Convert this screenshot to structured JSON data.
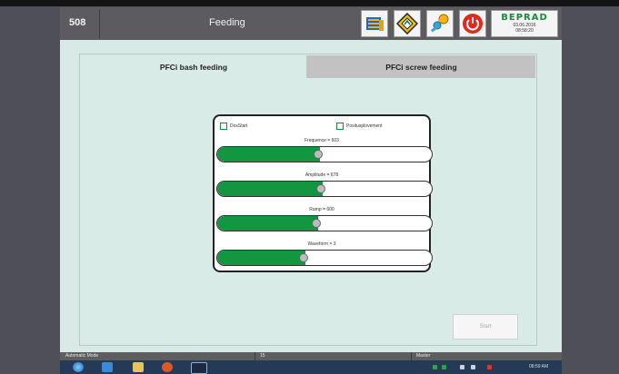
{
  "header": {
    "screen_number": "508",
    "title": "Feeding",
    "buttons": [
      "notebook-icon",
      "navigation-diamond-icon",
      "keys-icon",
      "power-icon"
    ],
    "brand": {
      "name": "BEPRAD",
      "date": "03.06.2016",
      "time": "08:58:20"
    }
  },
  "tabs": [
    {
      "label": "PFCi bash feeding",
      "active": true
    },
    {
      "label": "PFCi screw feeding",
      "active": false
    }
  ],
  "checkboxes": [
    {
      "label": "DosStart",
      "checked": false
    },
    {
      "label": "Positusplovement",
      "checked": false
    }
  ],
  "sliders": [
    {
      "label": "Frequence = 603",
      "value": 0.48
    },
    {
      "label": "Amplitude = 678",
      "value": 0.49
    },
    {
      "label": "Ramp = 600",
      "value": 0.47
    },
    {
      "label": "Waveform = 3",
      "value": 0.41
    }
  ],
  "start_button": {
    "label": "Start"
  },
  "status_bar": {
    "mode": "Automatic Mode",
    "id": "15",
    "user": "Master"
  },
  "taskbar": {
    "time": "08:59 AM",
    "accent": "#139640"
  }
}
